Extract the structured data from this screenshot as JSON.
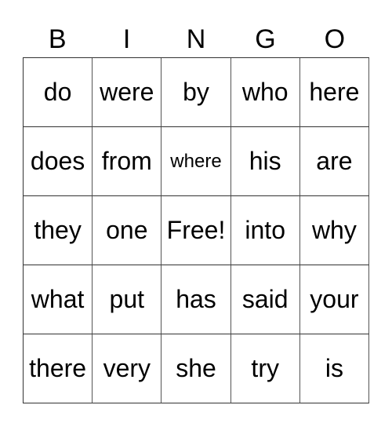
{
  "header": [
    "B",
    "I",
    "N",
    "G",
    "O"
  ],
  "cells": [
    [
      "do",
      "were",
      "by",
      "who",
      "here"
    ],
    [
      "does",
      "from",
      "where",
      "his",
      "are"
    ],
    [
      "they",
      "one",
      "Free!",
      "into",
      "why"
    ],
    [
      "what",
      "put",
      "has",
      "said",
      "your"
    ],
    [
      "there",
      "very",
      "she",
      "try",
      "is"
    ]
  ]
}
